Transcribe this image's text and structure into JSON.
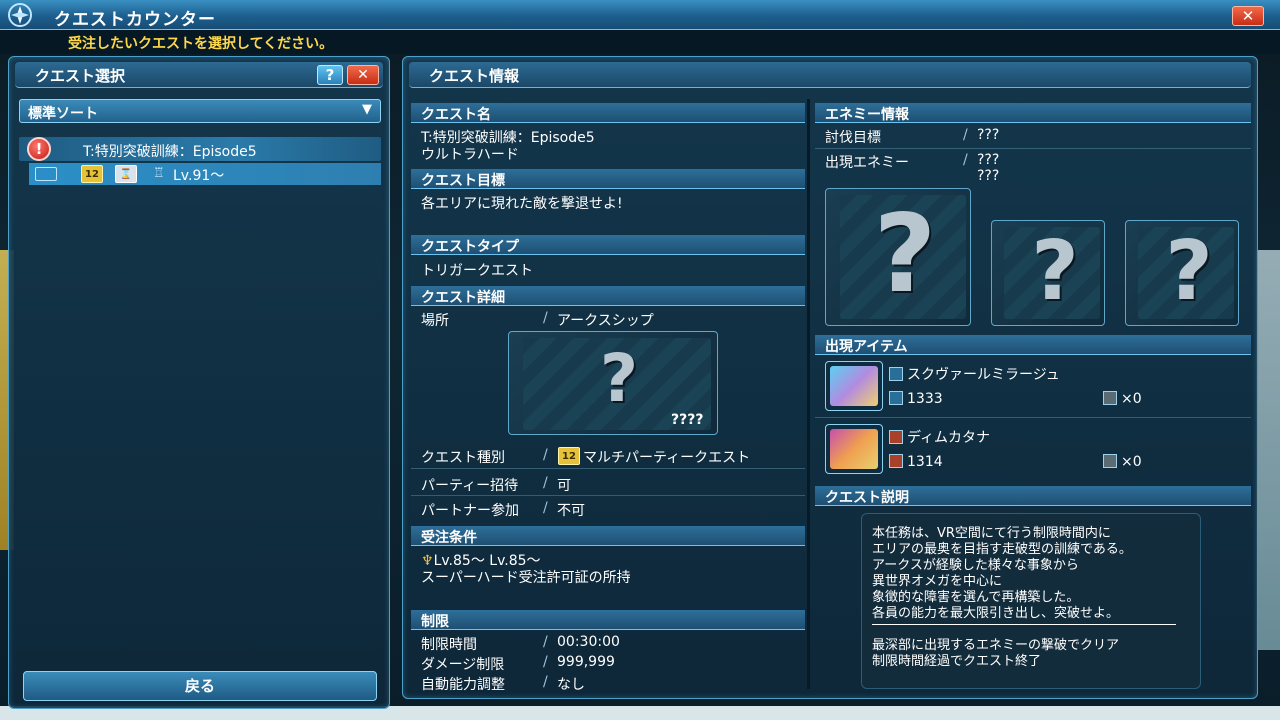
{
  "window": {
    "title": "クエストカウンター",
    "close_label": "✕",
    "instruction": "受注したいクエストを選択してください。"
  },
  "left": {
    "title": "クエスト選択",
    "help_label": "?",
    "close_label": "✕",
    "sort_label": "標準ソート",
    "quest": {
      "alert": "!",
      "name": "T:特別突破訓練：Episode5",
      "level": "Lv.91～"
    },
    "back_label": "戻る"
  },
  "right": {
    "title": "クエスト情報",
    "quest_name_head": "クエスト名",
    "quest_name_line1": "T:特別突破訓練：Episode5",
    "quest_name_line2": "ウルトラハード",
    "objective_head": "クエスト目標",
    "objective": "各エリアに現れた敵を撃退せよ!",
    "type_head": "クエストタイプ",
    "type": "トリガークエスト",
    "detail_head": "クエスト詳細",
    "location_label": "場所",
    "location_value": "アークスシップ",
    "location_qmark": "?",
    "location_code": "????",
    "kind_label": "クエスト種別",
    "kind_value": "マルチパーティークエスト",
    "party_label": "パーティー招待",
    "party_value": "可",
    "partner_label": "パートナー参加",
    "partner_value": "不可",
    "conditions_head": "受注条件",
    "condition_levels": "Lv.85～  Lv.85～",
    "condition_license": "スーパーハード受注許可証の所持",
    "limits_head": "制限",
    "time_label": "制限時間",
    "time_value": "00:30:00",
    "damage_label": "ダメージ制限",
    "damage_value": "999,999",
    "auto_label": "自動能力調整",
    "auto_value": "なし",
    "enemy_head": "エネミー情報",
    "target_label": "討伐目標",
    "target_value": "???",
    "appear_label": "出現エネミー",
    "appear_value1": "???",
    "appear_value2": "???",
    "enemy_qmark": "?",
    "items_head": "出現アイテム",
    "item1_name": "スクヴァールミラージュ",
    "item1_power": "1333",
    "item1_count": "×0",
    "item2_name": "ディムカタナ",
    "item2_power": "1314",
    "item2_count": "×0",
    "desc_head": "クエスト説明",
    "desc_lines": [
      "本任務は、VR空間にて行う制限時間内に",
      "エリアの最奥を目指す走破型の訓練である。",
      "アークスが経験した様々な事象から",
      "異世界オメガを中心に",
      "象徴的な障害を選んで再構築した。",
      "各員の能力を最大限引き出し、突破せよ。"
    ],
    "desc_clear_1": "最深部に出現するエネミーの撃破でクリア",
    "desc_clear_2": "制限時間経過でクエスト終了"
  }
}
